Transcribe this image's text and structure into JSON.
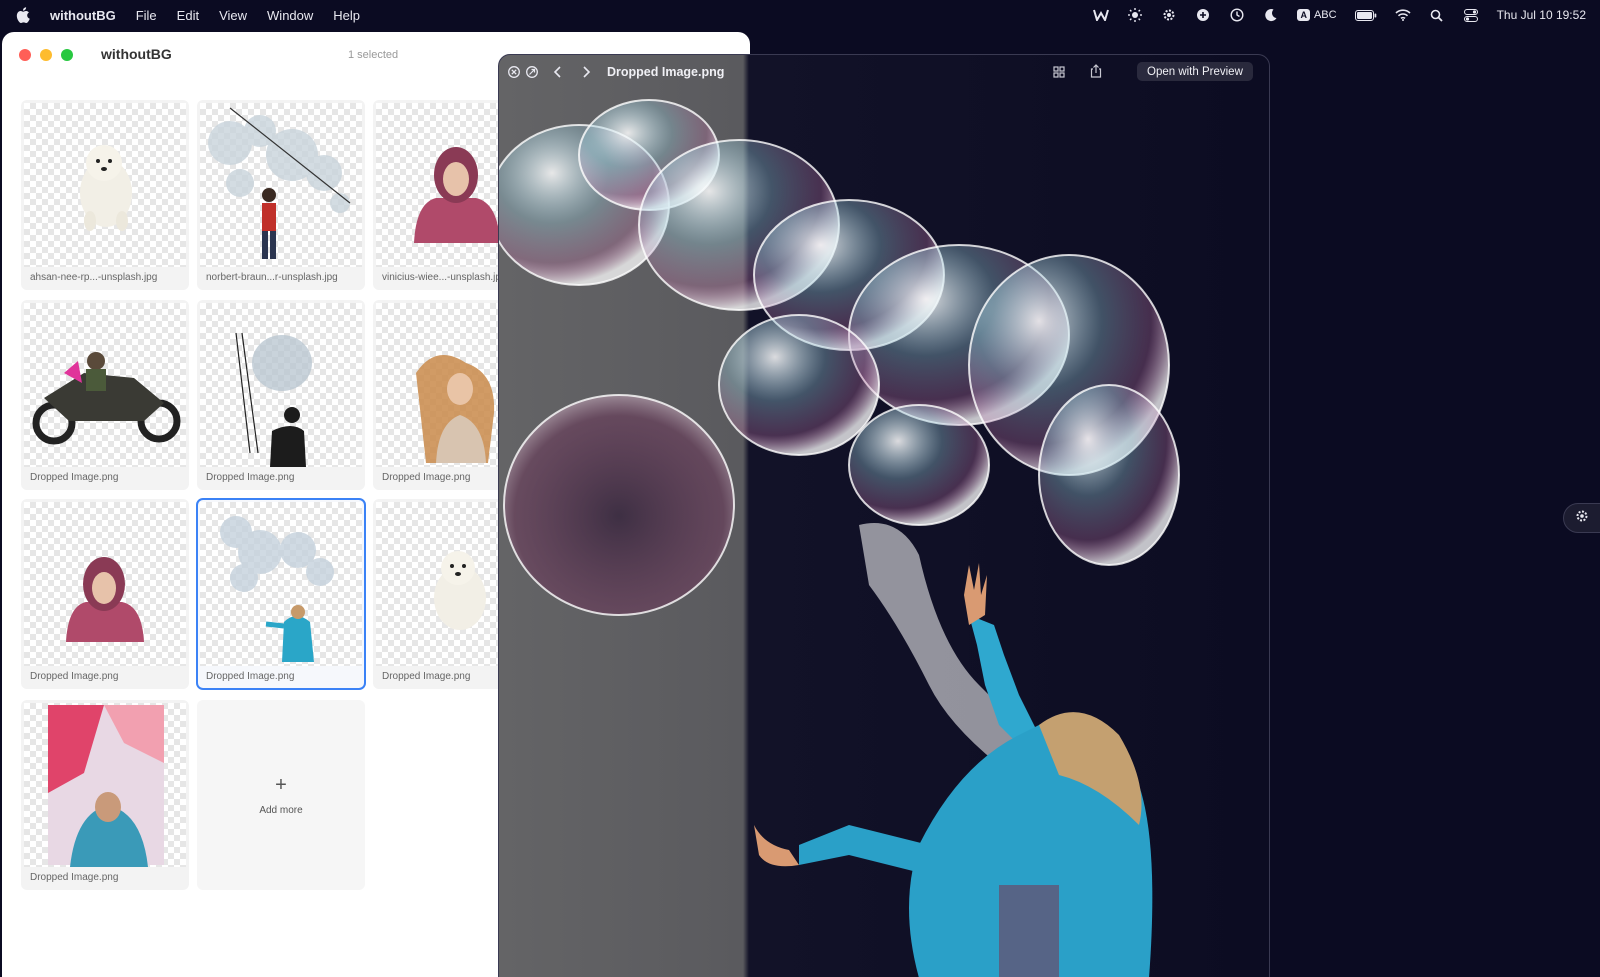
{
  "menubar": {
    "items": [
      "withoutBG",
      "File",
      "Edit",
      "View",
      "Window",
      "Help"
    ],
    "status_icons": [
      "wbg-icon",
      "brightness-icon",
      "gear-icon",
      "shield-icon",
      "clock-icon",
      "moon-icon"
    ],
    "input_source": "ABC",
    "clock": "Thu Jul 10  19:52"
  },
  "app": {
    "title": "withoutBG",
    "selected_text": "1 selected"
  },
  "tiles": [
    {
      "caption": "ahsan-nee-rp...-unsplash.jpg",
      "art": "dog"
    },
    {
      "caption": "norbert-braun...r-unsplash.jpg",
      "art": "bubble-man"
    },
    {
      "caption": "vinicius-wiee...-unsplash.jpg",
      "art": "woman"
    },
    {
      "caption": "Dropped Image.png",
      "art": "motorcycle"
    },
    {
      "caption": "Dropped Image.png",
      "art": "bubble-silhouette"
    },
    {
      "caption": "Dropped Image.png",
      "art": "woman-hair"
    },
    {
      "caption": "Dropped Image.png",
      "art": "woman"
    },
    {
      "caption": "Dropped Image.png",
      "art": "bubble-child"
    },
    {
      "caption": "Dropped Image.png",
      "art": "dog"
    },
    {
      "caption": "Dropped Image.png",
      "art": "colorful-woman"
    }
  ],
  "add_more": {
    "icon": "+",
    "label": "Add more"
  },
  "viewer": {
    "title": "Dropped Image.png",
    "open_button": "Open with Preview",
    "icons": [
      "close-icon",
      "fullscreen-icon",
      "chevron-left-icon",
      "chevron-right-icon",
      "grid-icon",
      "share-icon"
    ]
  },
  "colors": {
    "accent": "#3b82f6",
    "desktop": "#0b0b22",
    "close": "#ff5f57",
    "minimize": "#febc2e",
    "maximize": "#28c840"
  }
}
